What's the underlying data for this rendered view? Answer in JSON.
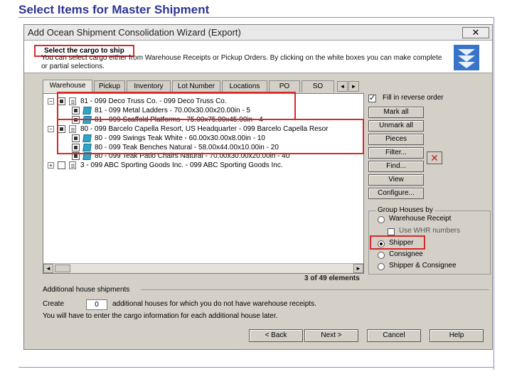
{
  "slide_title": "Select Items for Master Shipment",
  "window": {
    "title": "Add Ocean Shipment Consolidation Wizard (Export)",
    "close_label": "✕"
  },
  "header": {
    "heading": "Select the cargo to ship",
    "description": "You can select cargo either from Warehouse Receipts or Pickup Orders. By clicking on the white boxes you can make complete or partial selections."
  },
  "tabs": [
    "Warehouse",
    "Pickup",
    "Inventory",
    "Lot Number",
    "Locations",
    "PO",
    "SO"
  ],
  "tree": [
    {
      "level": 0,
      "expander": "−",
      "checkbox": "filled",
      "icon": "doc",
      "label": "81 - 099 Deco Truss Co. - 099 Deco Truss Co."
    },
    {
      "level": 1,
      "expander": "",
      "checkbox": "filled",
      "icon": "box",
      "label": "81 - 099 Metal Ladders - 70.00x30.00x20.00in - 5"
    },
    {
      "level": 1,
      "expander": "",
      "checkbox": "filled",
      "icon": "box",
      "label": "81 - 099 Scaffold Platforms - 75.00x75.00x45.00in - 4"
    },
    {
      "level": 0,
      "expander": "−",
      "checkbox": "filled",
      "icon": "doc",
      "label": "80 - 099 Barcelo Capella Resort, US Headquarter - 099 Barcelo Capella Resor"
    },
    {
      "level": 1,
      "expander": "",
      "checkbox": "filled",
      "icon": "box",
      "label": "80 - 099 Swings Teak White - 60.00x30.00x8.00in - 10"
    },
    {
      "level": 1,
      "expander": "",
      "checkbox": "filled",
      "icon": "box",
      "label": "80 - 099 Teak Benches Natural - 58.00x44.00x10.00in - 20"
    },
    {
      "level": 1,
      "expander": "",
      "checkbox": "filled",
      "icon": "box",
      "label": "80 - 099 Teak Patio Chairs Natural - 70.00x30.00x20.00in - 40"
    },
    {
      "level": 0,
      "expander": "+",
      "checkbox": "empty",
      "icon": "doc",
      "label": "3 - 099 ABC Sporting Goods Inc. - 099 ABC Sporting Goods Inc."
    }
  ],
  "elements_count": "3 of 49 elements",
  "fill_reverse": {
    "label": "Fill in reverse order",
    "checked": true
  },
  "side_buttons": [
    "Mark all",
    "Unmark all",
    "Pieces",
    "Filter...",
    "Find...",
    "View",
    "Configure..."
  ],
  "group_houses": {
    "title": "Group Houses by",
    "options": [
      "Warehouse Receipt",
      "Shipper",
      "Consignee",
      "Shipper & Consignee"
    ],
    "sub_option": "Use WHR numbers",
    "selected": "Shipper"
  },
  "additional": {
    "title": "Additional house shipments",
    "create_label": "Create",
    "create_value": "0",
    "create_desc": "additional houses for which you do not have warehouse receipts.",
    "note": "You will have to enter the cargo information for each additional house later."
  },
  "footer_buttons": {
    "back": "< Back",
    "next": "Next >",
    "cancel": "Cancel",
    "help": "Help"
  },
  "colors": {
    "highlight": "#d52a2a",
    "title": "#2f3490",
    "dialog": "#d4d0c8"
  }
}
